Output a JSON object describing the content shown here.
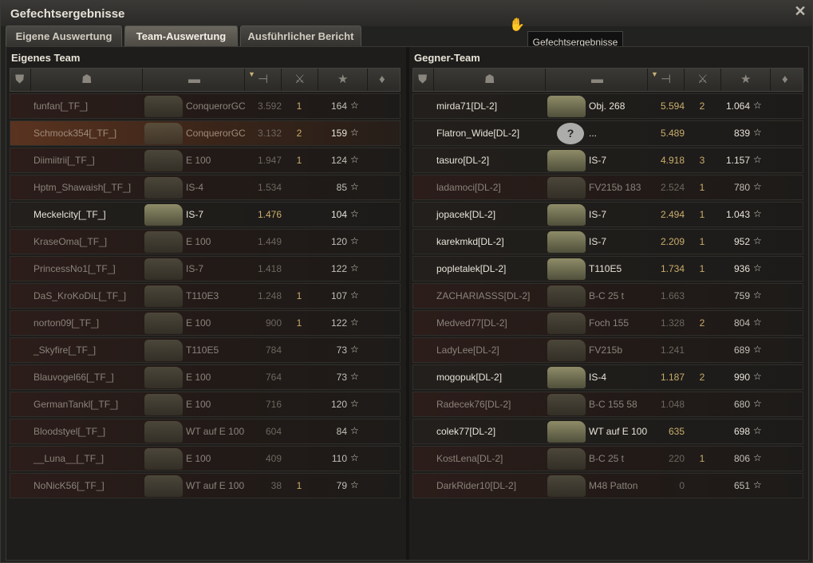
{
  "window": {
    "title": "Gefechtsergebnisse",
    "close_icon": "close-icon"
  },
  "tabs": [
    {
      "label": "Eigene Auswertung",
      "active": false
    },
    {
      "label": "Team-Auswertung",
      "active": true
    },
    {
      "label": "Ausführlicher Bericht",
      "active": false
    }
  ],
  "tooltip": {
    "text": "Gefechtsergebnisse"
  },
  "columns": {
    "icons": [
      "squad-icon",
      "player-icon",
      "tank-icon",
      "experience-sort-icon",
      "kills-icon",
      "star-icon",
      "medal-icon"
    ]
  },
  "own_team": {
    "title": "Eigenes Team",
    "players": [
      {
        "name": "funfan[_TF_]",
        "tank": "ConquerorGC",
        "xp": "3.592",
        "kills": "1",
        "damage": "164",
        "state": "dead"
      },
      {
        "name": "Schmock354[_TF_]",
        "tank": "ConquerorGC",
        "xp": "3.132",
        "kills": "2",
        "damage": "159",
        "state": "me"
      },
      {
        "name": "Diimiitrii[_TF_]",
        "tank": "E 100",
        "xp": "1.947",
        "kills": "1",
        "damage": "124",
        "state": "dead"
      },
      {
        "name": "Hptm_Shawaish[_TF_]",
        "tank": "IS-4",
        "xp": "1.534",
        "kills": "",
        "damage": "85",
        "state": "dead"
      },
      {
        "name": "Meckelcity[_TF_]",
        "tank": "IS-7",
        "xp": "1.476",
        "kills": "",
        "damage": "104",
        "state": "alive"
      },
      {
        "name": "KraseOma[_TF_]",
        "tank": "E 100",
        "xp": "1.449",
        "kills": "",
        "damage": "120",
        "state": "dead"
      },
      {
        "name": "PrincessNo1[_TF_]",
        "tank": "IS-7",
        "xp": "1.418",
        "kills": "",
        "damage": "122",
        "state": "dead"
      },
      {
        "name": "DaS_KroKoDiL[_TF_]",
        "tank": "T110E3",
        "xp": "1.248",
        "kills": "1",
        "damage": "107",
        "state": "dead"
      },
      {
        "name": "norton09[_TF_]",
        "tank": "E 100",
        "xp": "900",
        "kills": "1",
        "damage": "122",
        "state": "dead"
      },
      {
        "name": "_Skyfire[_TF_]",
        "tank": "T110E5",
        "xp": "784",
        "kills": "",
        "damage": "73",
        "state": "dead"
      },
      {
        "name": "Blauvogel66[_TF_]",
        "tank": "E 100",
        "xp": "764",
        "kills": "",
        "damage": "73",
        "state": "dead"
      },
      {
        "name": "GermanTankl[_TF_]",
        "tank": "E 100",
        "xp": "716",
        "kills": "",
        "damage": "120",
        "state": "dead"
      },
      {
        "name": "Bloodstyel[_TF_]",
        "tank": "WT auf E 100",
        "xp": "604",
        "kills": "",
        "damage": "84",
        "state": "dead"
      },
      {
        "name": "__Luna__[_TF_]",
        "tank": "E 100",
        "xp": "409",
        "kills": "",
        "damage": "110",
        "state": "dead"
      },
      {
        "name": "NoNicK56[_TF_]",
        "tank": "WT auf E 100",
        "xp": "38",
        "kills": "1",
        "damage": "79",
        "state": "dead"
      }
    ]
  },
  "enemy_team": {
    "title": "Gegner-Team",
    "players": [
      {
        "name": "mirda71[DL-2]",
        "tank": "Obj. 268",
        "xp": "5.594",
        "kills": "2",
        "damage": "1.064",
        "state": "alive"
      },
      {
        "name": "Flatron_Wide[DL-2]",
        "tank": "...",
        "xp": "5.489",
        "kills": "",
        "damage": "839",
        "state": "alive",
        "unknown": true
      },
      {
        "name": "tasuro[DL-2]",
        "tank": "IS-7",
        "xp": "4.918",
        "kills": "3",
        "damage": "1.157",
        "state": "alive"
      },
      {
        "name": "ladamoci[DL-2]",
        "tank": "FV215b 183",
        "xp": "2.524",
        "kills": "1",
        "damage": "780",
        "state": "dead"
      },
      {
        "name": "jopacek[DL-2]",
        "tank": "IS-7",
        "xp": "2.494",
        "kills": "1",
        "damage": "1.043",
        "state": "alive"
      },
      {
        "name": "karekmkd[DL-2]",
        "tank": "IS-7",
        "xp": "2.209",
        "kills": "1",
        "damage": "952",
        "state": "alive"
      },
      {
        "name": "popletalek[DL-2]",
        "tank": "T110E5",
        "xp": "1.734",
        "kills": "1",
        "damage": "936",
        "state": "alive"
      },
      {
        "name": "ZACHARIASSS[DL-2]",
        "tank": "B-C 25 t",
        "xp": "1.663",
        "kills": "",
        "damage": "759",
        "state": "dead"
      },
      {
        "name": "Medved77[DL-2]",
        "tank": "Foch 155",
        "xp": "1.328",
        "kills": "2",
        "damage": "804",
        "state": "dead"
      },
      {
        "name": "LadyLee[DL-2]",
        "tank": "FV215b",
        "xp": "1.241",
        "kills": "",
        "damage": "689",
        "state": "dead"
      },
      {
        "name": "mogopuk[DL-2]",
        "tank": "IS-4",
        "xp": "1.187",
        "kills": "2",
        "damage": "990",
        "state": "alive"
      },
      {
        "name": "Radecek76[DL-2]",
        "tank": "B-C 155 58",
        "xp": "1.048",
        "kills": "",
        "damage": "680",
        "state": "dead"
      },
      {
        "name": "colek77[DL-2]",
        "tank": "WT auf E 100",
        "xp": "635",
        "kills": "",
        "damage": "698",
        "state": "alive"
      },
      {
        "name": "KostLena[DL-2]",
        "tank": "B-C 25 t",
        "xp": "220",
        "kills": "1",
        "damage": "806",
        "state": "dead"
      },
      {
        "name": "DarkRider10[DL-2]",
        "tank": "M48 Patton",
        "xp": "0",
        "kills": "",
        "damage": "651",
        "state": "dead"
      }
    ]
  }
}
